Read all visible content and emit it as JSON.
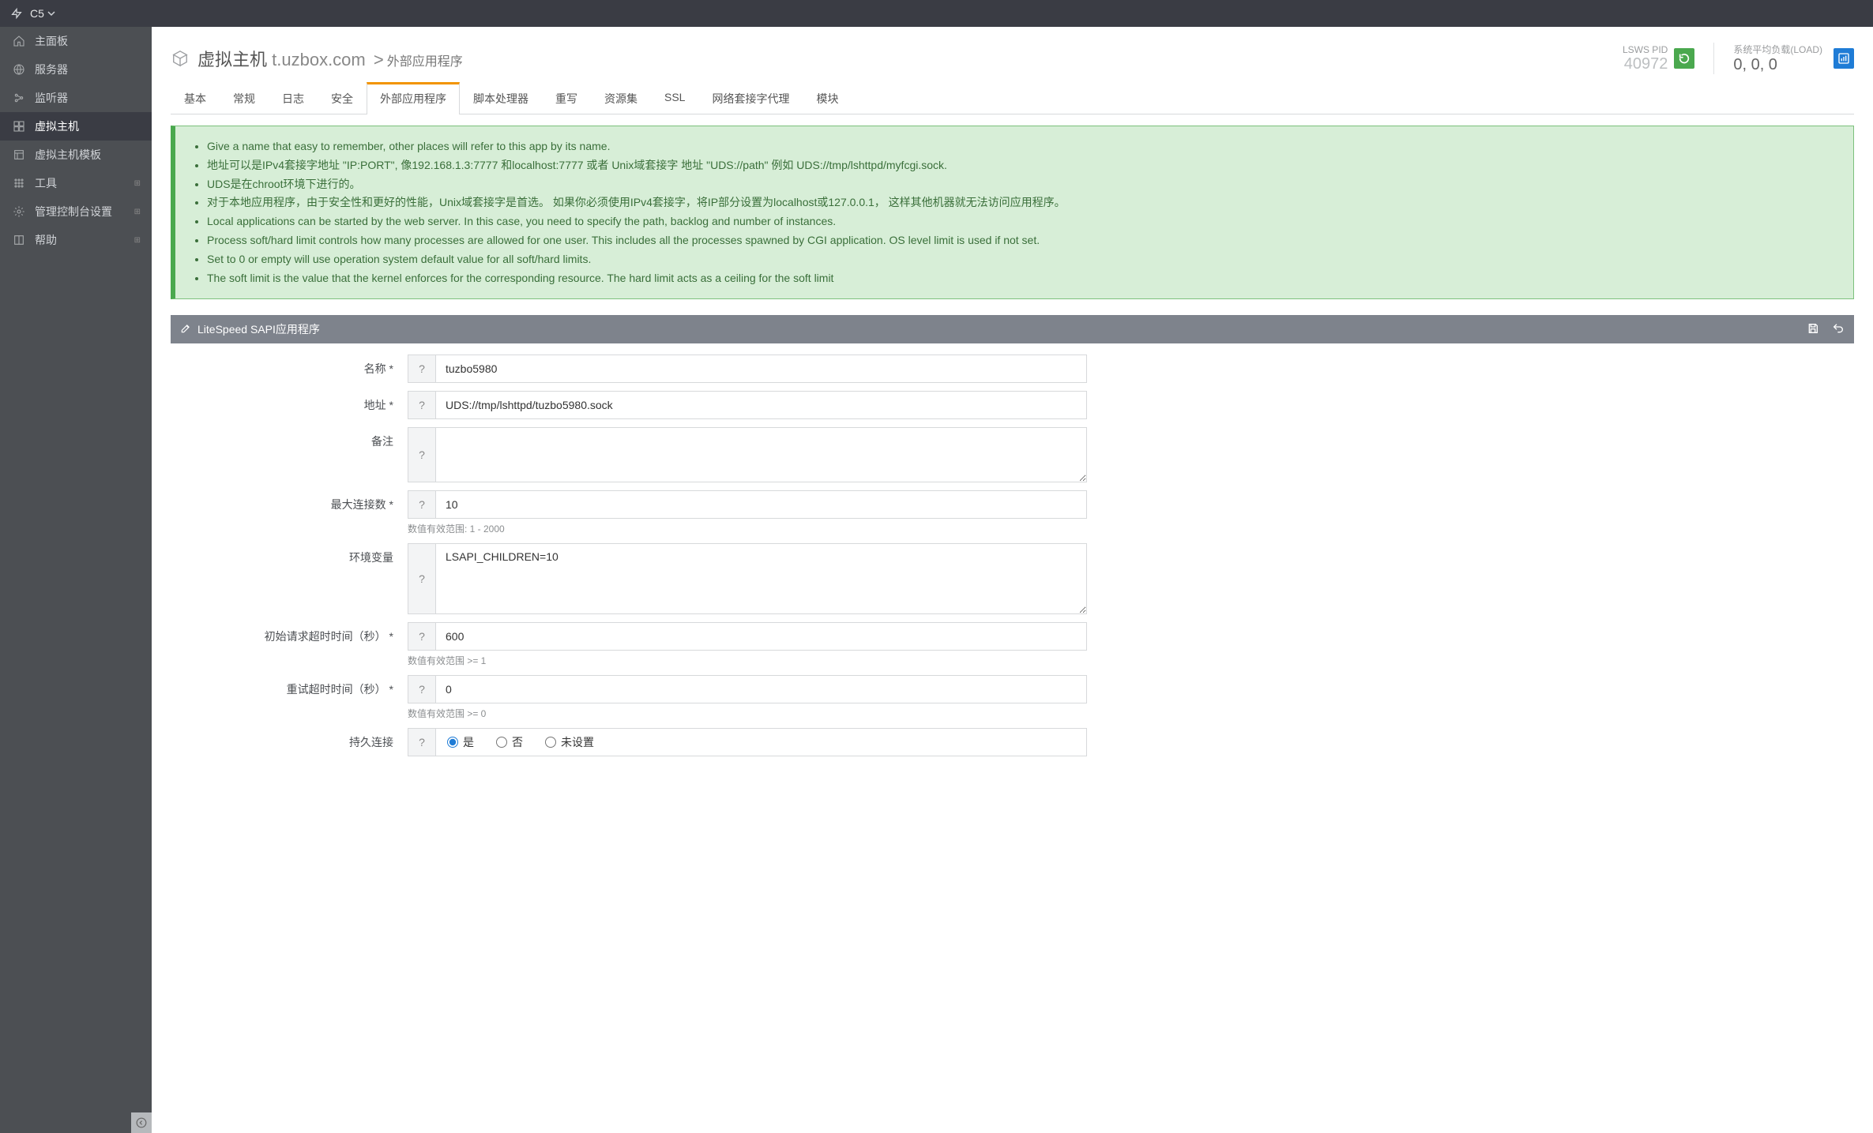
{
  "topbar": {
    "site": "C5"
  },
  "sidebar": {
    "items": [
      {
        "label": "主面板",
        "icon": "home"
      },
      {
        "label": "服务器",
        "icon": "globe"
      },
      {
        "label": "监听器",
        "icon": "link"
      },
      {
        "label": "虚拟主机",
        "icon": "boxes",
        "active": true
      },
      {
        "label": "虚拟主机模板",
        "icon": "template"
      },
      {
        "label": "工具",
        "icon": "grid",
        "expandable": true
      },
      {
        "label": "管理控制台设置",
        "icon": "gear",
        "expandable": true
      },
      {
        "label": "帮助",
        "icon": "book",
        "expandable": true
      }
    ]
  },
  "header": {
    "title_prefix": "虚拟主机",
    "title_host": "t.uzbox.com",
    "crumb_sep": ">",
    "sub": "外部应用程序",
    "pid_label": "LSWS PID",
    "pid_value": "40972",
    "load_label": "系统平均负载(LOAD)",
    "load_value": "0, 0, 0"
  },
  "tabs": [
    {
      "label": "基本"
    },
    {
      "label": "常规"
    },
    {
      "label": "日志"
    },
    {
      "label": "安全"
    },
    {
      "label": "外部应用程序",
      "active": true
    },
    {
      "label": "脚本处理器"
    },
    {
      "label": "重写"
    },
    {
      "label": "资源集"
    },
    {
      "label": "SSL"
    },
    {
      "label": "网络套接字代理"
    },
    {
      "label": "模块"
    }
  ],
  "help": {
    "lines": [
      "Give a name that easy to remember, other places will refer to this app by its name.",
      "地址可以是IPv4套接字地址 \"IP:PORT\", 像192.168.1.3:7777 和localhost:7777 或者 Unix域套接字 地址 \"UDS://path\" 例如 UDS://tmp/lshttpd/myfcgi.sock.",
      "UDS是在chroot环境下进行的。",
      "对于本地应用程序，由于安全性和更好的性能，Unix域套接字是首选。 如果你必须使用IPv4套接字，将IP部分设置为localhost或127.0.0.1， 这样其他机器就无法访问应用程序。",
      "Local applications can be started by the web server. In this case, you need to specify the path, backlog and number of instances.",
      "Process soft/hard limit controls how many processes are allowed for one user. This includes all the processes spawned by CGI application. OS level limit is used if not set.",
      "Set to 0 or empty will use operation system default value for all soft/hard limits.",
      "The soft limit is the value that the kernel enforces for the corresponding resource. The hard limit acts as a ceiling for the soft limit"
    ]
  },
  "panel": {
    "title": "LiteSpeed SAPI应用程序"
  },
  "form": {
    "name": {
      "label": "名称 *",
      "value": "tuzbo5980"
    },
    "address": {
      "label": "地址 *",
      "value": "UDS://tmp/lshttpd/tuzbo5980.sock"
    },
    "notes": {
      "label": "备注",
      "value": ""
    },
    "maxconn": {
      "label": "最大连接数 *",
      "value": "10",
      "hint": "数值有效范围: 1 - 2000"
    },
    "env": {
      "label": "环境变量",
      "value": "LSAPI_CHILDREN=10"
    },
    "init_timeout": {
      "label": "初始请求超时时间（秒） *",
      "value": "600",
      "hint": "数值有效范围 >= 1"
    },
    "retry_timeout": {
      "label": "重试超时时间（秒） *",
      "value": "0",
      "hint": "数值有效范围 >= 0"
    },
    "persistent": {
      "label": "持久连接",
      "opt_yes": "是",
      "opt_no": "否",
      "opt_unset": "未设置"
    }
  }
}
